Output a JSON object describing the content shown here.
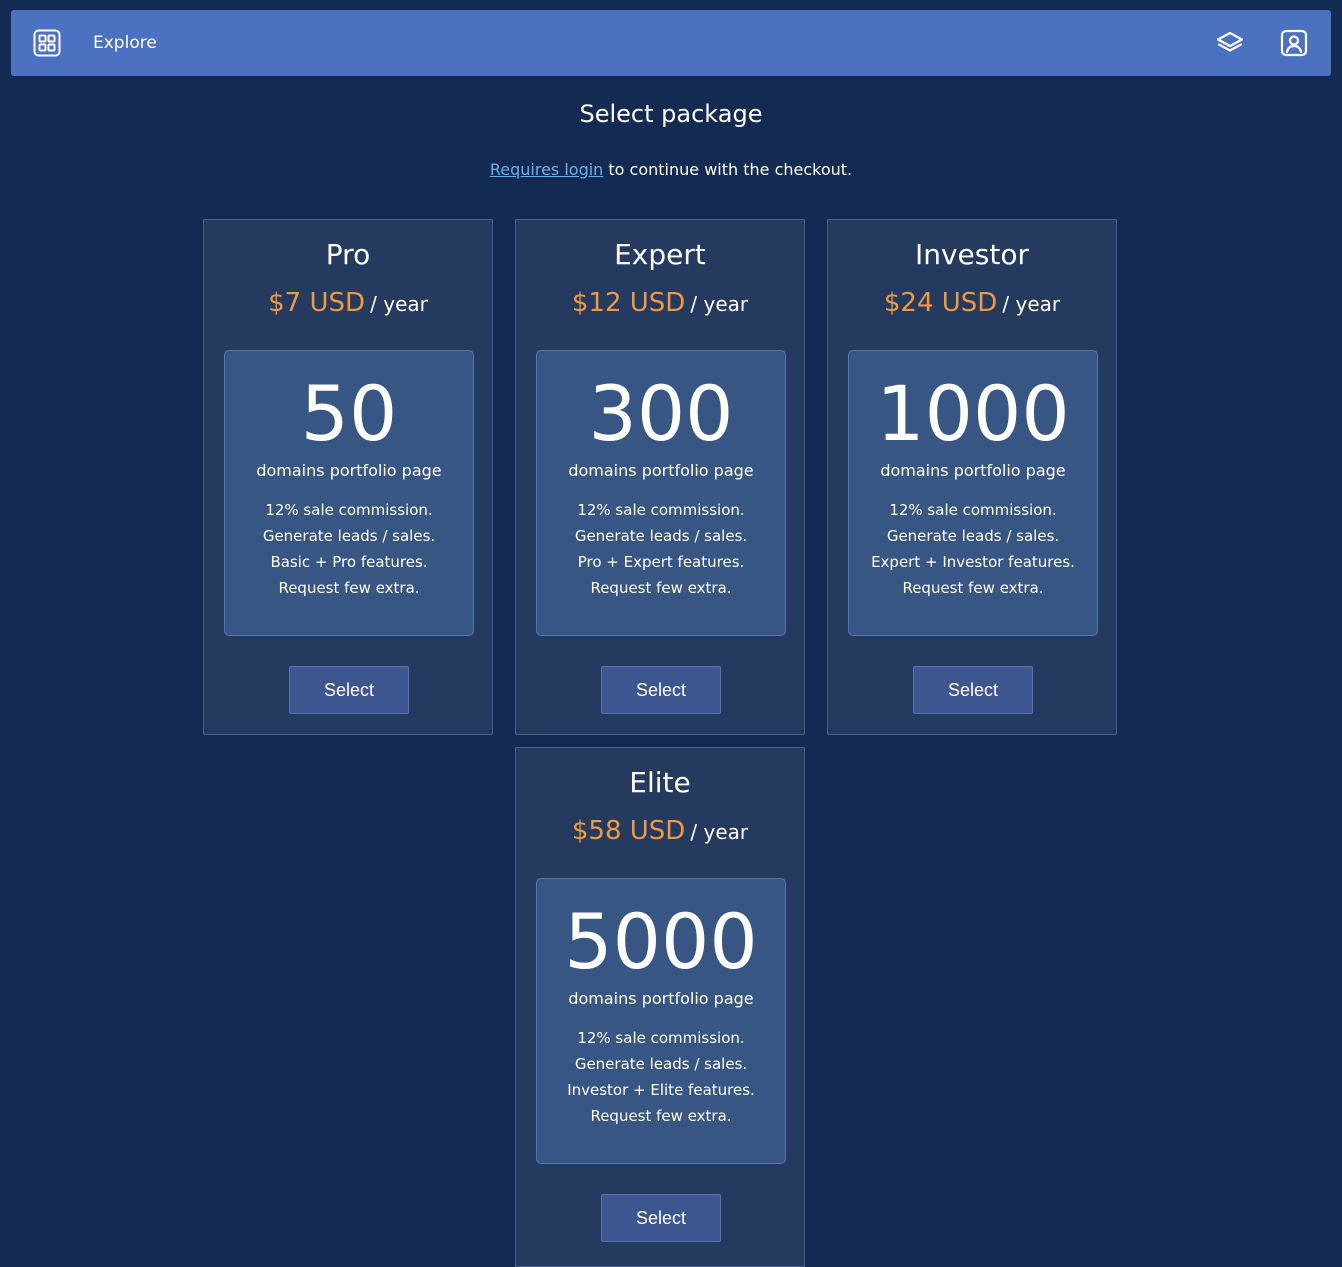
{
  "nav": {
    "explore_label": "Explore",
    "grid_icon": "grid-icon",
    "layers_icon": "layers-icon",
    "user_icon": "user-badge-icon",
    "bar_color": "#4c71c0"
  },
  "page": {
    "title": "Select package",
    "login_link": "Requires login",
    "login_text": " to continue with the checkout.",
    "background_color": "#132a52",
    "price_color": "#f0993e"
  },
  "packages": [
    {
      "name": "Pro",
      "price": "$7 USD",
      "period": "/ year",
      "domains": "50",
      "domains_label": "domains portfolio page",
      "features": [
        "12% sale commission.",
        "Generate leads / sales.",
        "Basic + Pro features.",
        "Request few extra."
      ],
      "button": "Select"
    },
    {
      "name": "Expert",
      "price": "$12 USD",
      "period": "/ year",
      "domains": "300",
      "domains_label": "domains portfolio page",
      "features": [
        "12% sale commission.",
        "Generate leads / sales.",
        "Pro + Expert features.",
        "Request few extra."
      ],
      "button": "Select"
    },
    {
      "name": "Investor",
      "price": "$24 USD",
      "period": "/ year",
      "domains": "1000",
      "domains_label": "domains portfolio page",
      "features": [
        "12% sale commission.",
        "Generate leads / sales.",
        "Expert + Investor features.",
        "Request few extra."
      ],
      "button": "Select"
    },
    {
      "name": "Elite",
      "price": "$58 USD",
      "period": "/ year",
      "domains": "5000",
      "domains_label": "domains portfolio page",
      "features": [
        "12% sale commission.",
        "Generate leads / sales.",
        "Investor + Elite features.",
        "Request few extra."
      ],
      "button": "Select"
    }
  ]
}
